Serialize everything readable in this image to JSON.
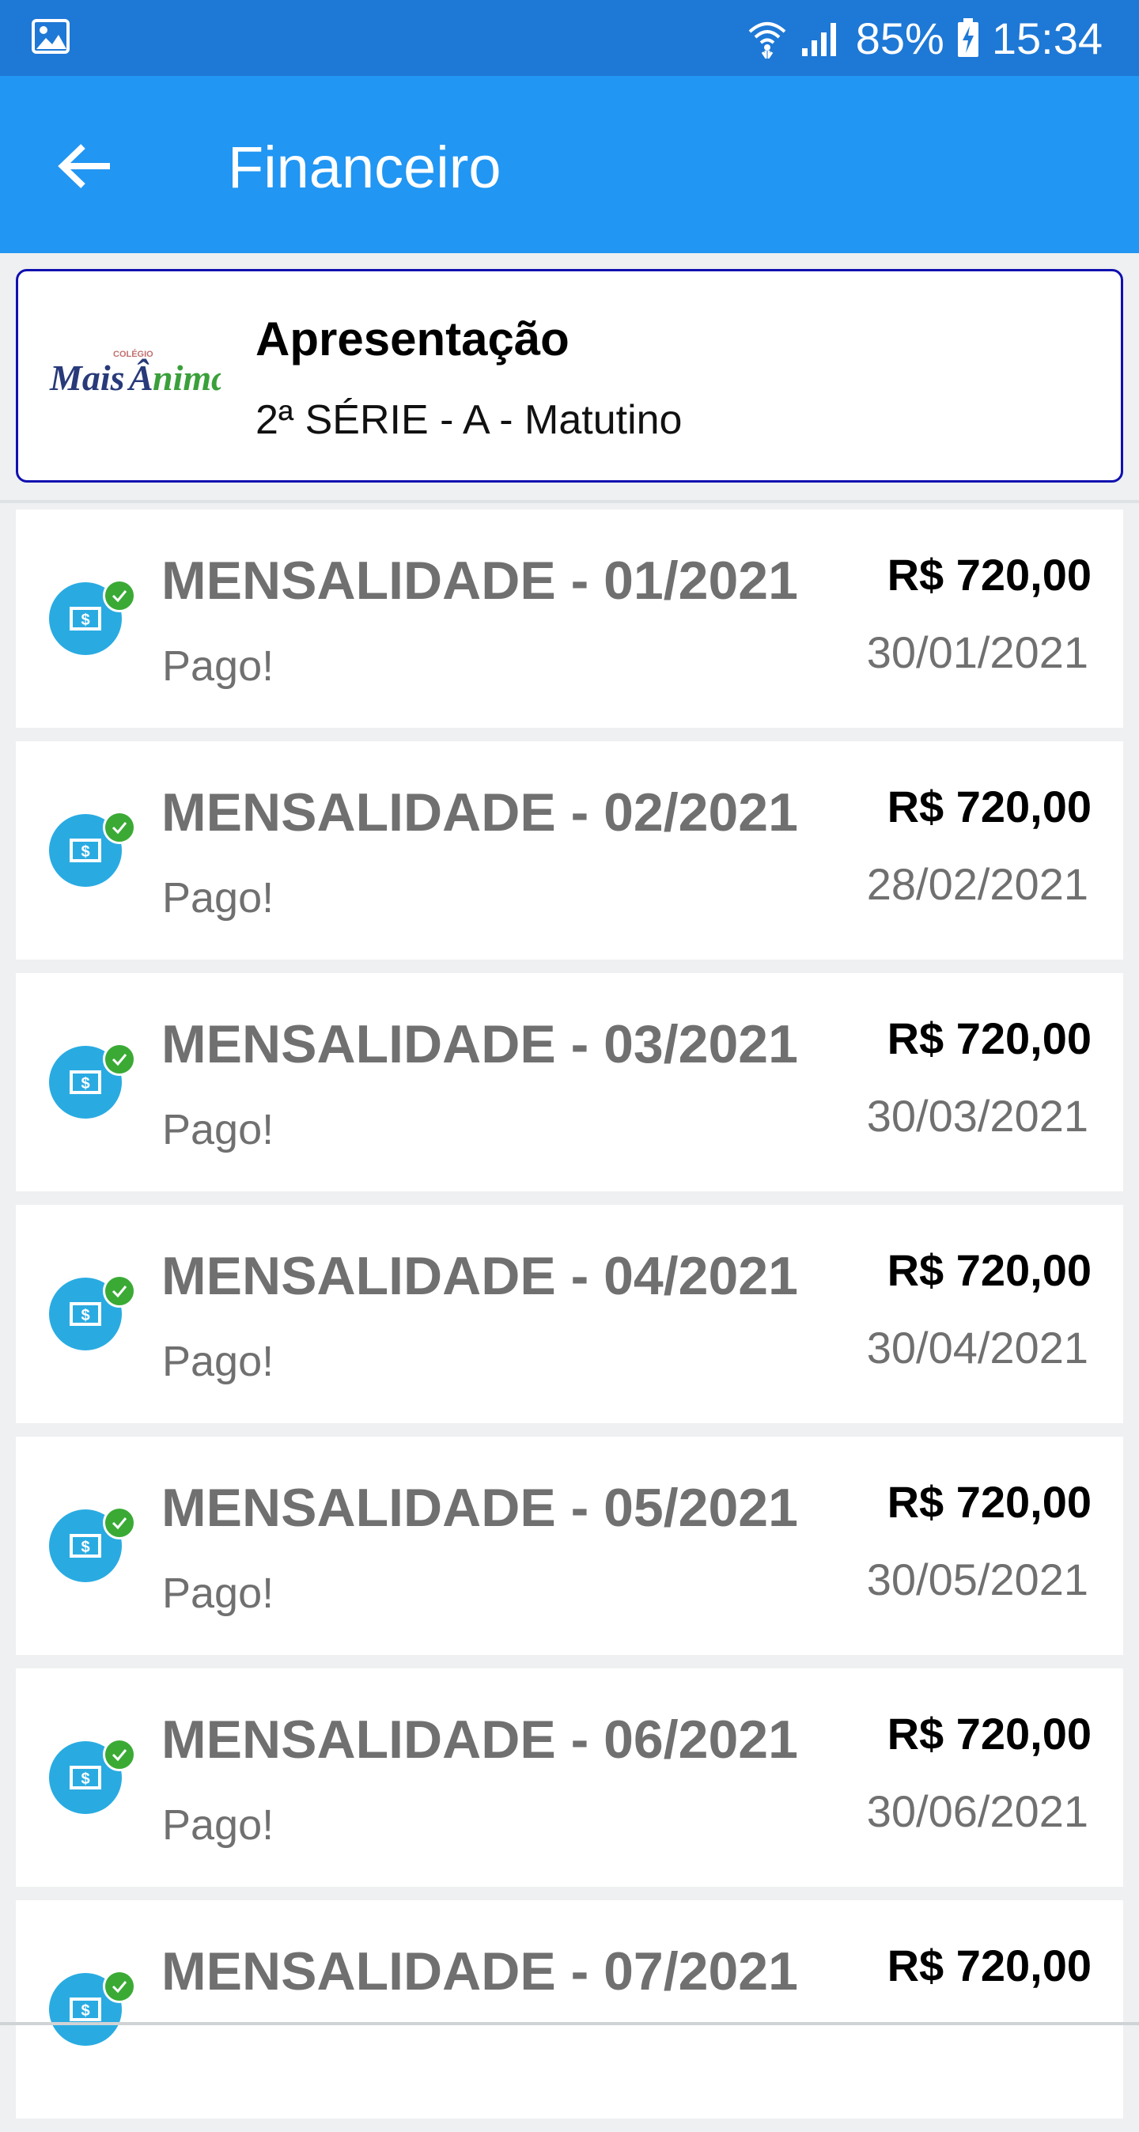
{
  "status_bar": {
    "battery": "85%",
    "time": "15:34"
  },
  "app_bar": {
    "title": "Financeiro"
  },
  "school": {
    "name": "Apresentação",
    "class": "2ª SÉRIE - A - Matutino",
    "logo_text": "Mais Ânima"
  },
  "payments": [
    {
      "title": "MENSALIDADE - 01/2021",
      "status": "Pago!",
      "amount": "R$ 720,00",
      "date": "30/01/2021"
    },
    {
      "title": "MENSALIDADE - 02/2021",
      "status": "Pago!",
      "amount": "R$ 720,00",
      "date": "28/02/2021"
    },
    {
      "title": "MENSALIDADE - 03/2021",
      "status": "Pago!",
      "amount": "R$ 720,00",
      "date": "30/03/2021"
    },
    {
      "title": "MENSALIDADE - 04/2021",
      "status": "Pago!",
      "amount": "R$ 720,00",
      "date": "30/04/2021"
    },
    {
      "title": "MENSALIDADE - 05/2021",
      "status": "Pago!",
      "amount": "R$ 720,00",
      "date": "30/05/2021"
    },
    {
      "title": "MENSALIDADE - 06/2021",
      "status": "Pago!",
      "amount": "R$ 720,00",
      "date": "30/06/2021"
    },
    {
      "title": "MENSALIDADE - 07/2021",
      "status": "",
      "amount": "R$ 720,00",
      "date": ""
    }
  ],
  "colors": {
    "status_bar": "#1e78d6",
    "app_bar": "#2196f3",
    "icon_blue": "#29abe2",
    "check_green": "#3aaa35",
    "card_border": "#1010b0"
  },
  "icons": {
    "status_left": "image-icon",
    "wifi": "wifi-icon",
    "signal": "signal-icon",
    "battery": "battery-charging-icon",
    "back": "arrow-back-icon",
    "item": "money-icon",
    "check": "check-icon"
  }
}
